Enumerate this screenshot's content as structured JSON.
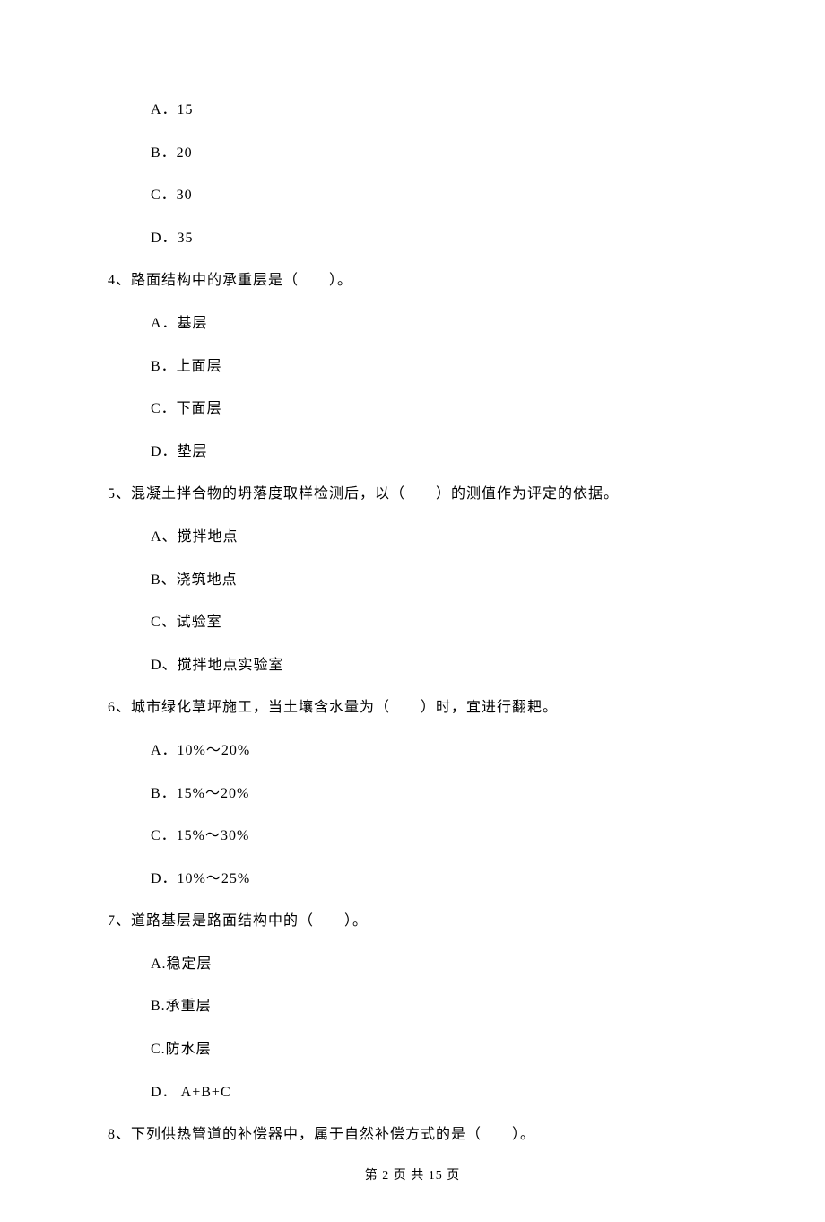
{
  "q3": {
    "options": {
      "A": "A．15",
      "B": "B．20",
      "C": "C．30",
      "D": "D．35"
    }
  },
  "q4": {
    "stem": "4、路面结构中的承重层是（　　）。",
    "options": {
      "A": "A．基层",
      "B": "B．上面层",
      "C": "C．下面层",
      "D": "D．垫层"
    }
  },
  "q5": {
    "stem": "5、混凝土拌合物的坍落度取样检测后，以（　　）的测值作为评定的依据。",
    "options": {
      "A": "A、搅拌地点",
      "B": "B、浇筑地点",
      "C": "C、试验室",
      "D": "D、搅拌地点实验室"
    }
  },
  "q6": {
    "stem": "6、城市绿化草坪施工，当土壤含水量为（　　）时，宜进行翻耙。",
    "options": {
      "A": "A．10%～20%",
      "B": "B．15%～20%",
      "C": "C．15%～30%",
      "D": "D．10%～25%"
    }
  },
  "q7": {
    "stem": "7、道路基层是路面结构中的（　　）。",
    "options": {
      "A": "A.稳定层",
      "B": "B.承重层",
      "C": "C.防水层",
      "D": "D． A+B+C"
    }
  },
  "q8": {
    "stem": "8、下列供热管道的补偿器中，属于自然补偿方式的是（　　）。"
  },
  "footer": "第 2 页 共 15 页"
}
